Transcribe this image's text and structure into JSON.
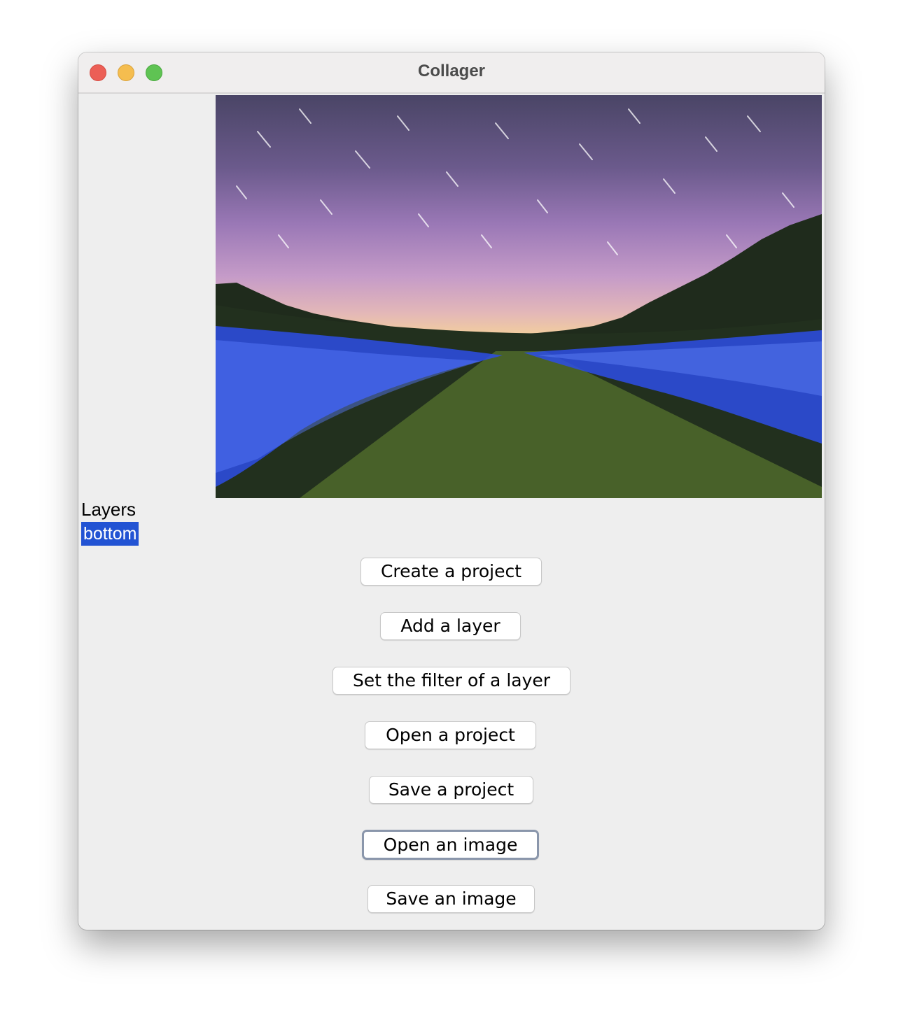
{
  "window": {
    "title": "Collager"
  },
  "layers": {
    "label": "Layers",
    "items": [
      "bottom"
    ],
    "selected": "bottom"
  },
  "buttons": {
    "create_project": "Create a project",
    "add_layer": "Add a layer",
    "set_filter": "Set the filter of a layer",
    "open_project": "Open a project",
    "save_project": "Save a project",
    "open_image": "Open an image",
    "save_image": "Save an image"
  },
  "colors": {
    "selection": "#2253d3",
    "focus_ring": "#8a96ab"
  }
}
